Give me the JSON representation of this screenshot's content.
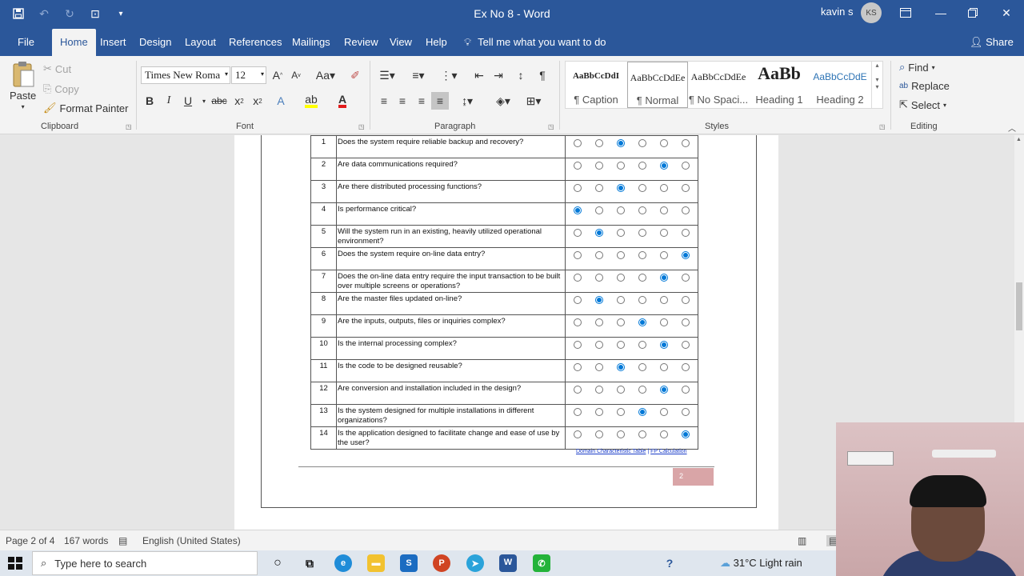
{
  "title_bar": {
    "title": "Ex No 8  -  Word",
    "user_name": "kavin s",
    "user_initials": "KS"
  },
  "tabs": [
    "File",
    "Home",
    "Insert",
    "Design",
    "Layout",
    "References",
    "Mailings",
    "Review",
    "View",
    "Help"
  ],
  "active_tab": "Home",
  "tell_me": "Tell me what you want to do",
  "share": "Share",
  "ribbon": {
    "clipboard": {
      "paste": "Paste",
      "cut": "Cut",
      "copy": "Copy",
      "format_painter": "Format Painter",
      "label": "Clipboard"
    },
    "font": {
      "name": "Times New Roma",
      "size": "12",
      "label": "Font"
    },
    "paragraph": {
      "label": "Paragraph"
    },
    "styles": {
      "label": "Styles",
      "items": [
        {
          "sample": "AaBbCcDdI",
          "name": "¶ Caption"
        },
        {
          "sample": "AaBbCcDdEe",
          "name": "¶ Normal"
        },
        {
          "sample": "AaBbCcDdEe",
          "name": "¶ No Spaci..."
        },
        {
          "sample": "AaBb",
          "name": "Heading 1"
        },
        {
          "sample": "AaBbCcDdE",
          "name": "Heading 2"
        }
      ],
      "selected": "¶ Normal"
    },
    "editing": {
      "find": "Find",
      "replace": "Replace",
      "select": "Select",
      "label": "Editing"
    }
  },
  "document": {
    "questions": [
      {
        "num": "1",
        "text": "Does the system require reliable backup and recovery?",
        "selected": 3
      },
      {
        "num": "2",
        "text": "Are data communications required?",
        "selected": 5
      },
      {
        "num": "3",
        "text": "Are there distributed processing functions?",
        "selected": 3
      },
      {
        "num": "4",
        "text": "Is performance critical?",
        "selected": 1
      },
      {
        "num": "5",
        "text": "Will the system run in an existing, heavily utilized operational environment?",
        "selected": 2
      },
      {
        "num": "6",
        "text": "Does the system require on-line data entry?",
        "selected": 6
      },
      {
        "num": "7",
        "text": "Does the on-line data entry require the input transaction to be built over multiple screens or operations?",
        "selected": 5
      },
      {
        "num": "8",
        "text": "Are the master files updated on-line?",
        "selected": 2
      },
      {
        "num": "9",
        "text": "Are the inputs, outputs, files or inquiries complex?",
        "selected": 4
      },
      {
        "num": "10",
        "text": "Is the internal processing complex?",
        "selected": 5
      },
      {
        "num": "11",
        "text": "Is the code to be designed reusable?",
        "selected": 3
      },
      {
        "num": "12",
        "text": "Are conversion and installation included in the design?",
        "selected": 5
      },
      {
        "num": "13",
        "text": "Is the system designed for multiple installations in different organizations?",
        "selected": 4
      },
      {
        "num": "14",
        "text": "Is the application designed to facilitate change and ease of use by the user?",
        "selected": 6
      }
    ],
    "link_1": "Domain Characteristic Table",
    "link_sep": "|",
    "link_2": "FP Calculation",
    "page_number": "2"
  },
  "status_bar": {
    "page": "Page 2 of 4",
    "words": "167 words",
    "language": "English (United States)"
  },
  "taskbar": {
    "search_placeholder": "Type here to search",
    "weather": "31°C  Light rain"
  }
}
